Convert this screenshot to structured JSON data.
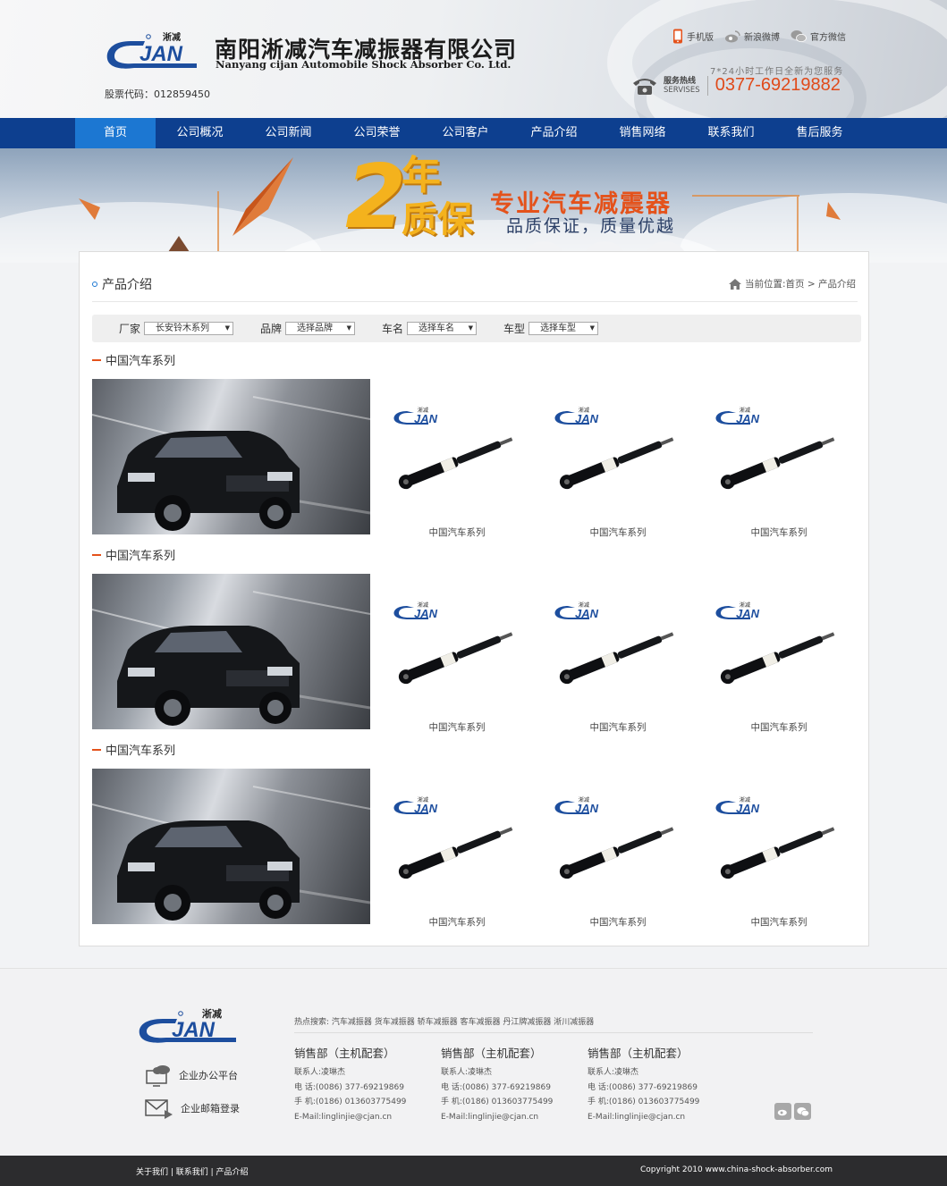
{
  "header": {
    "company_cn": "南阳淅减汽车减振器有限公司",
    "company_en": "Nanyang cijan Automobile Shock Absorber Co. Ltd.",
    "logo_cn": "淅减",
    "stock_code": "股票代码：012859450",
    "links": [
      {
        "label": "手机版",
        "icon": "mobile-icon"
      },
      {
        "label": "新浪微博",
        "icon": "weibo-icon"
      },
      {
        "label": "官方微信",
        "icon": "wechat-icon"
      }
    ],
    "service_note": "7*24小时工作日全新为您服务",
    "hotline_label": "服务热线",
    "hotline_en": "SERVISES",
    "phone": "0377-69219882"
  },
  "nav": {
    "items": [
      "首页",
      "公司概况",
      "公司新闻",
      "公司荣誉",
      "公司客户",
      "产品介绍",
      "销售网络",
      "联系我们",
      "售后服务"
    ],
    "active": "首页"
  },
  "banner": {
    "big_number": "2",
    "nian": "年",
    "zhibao": "质保",
    "title": "专业汽车减震器",
    "subtitle": "品质保证，质量优越"
  },
  "section": {
    "title": "产品介绍",
    "breadcrumb": "当前位置:首页 > 产品介绍"
  },
  "filters": [
    {
      "label": "厂家",
      "value": "长安铃木系列"
    },
    {
      "label": "品牌",
      "value": "选择品牌"
    },
    {
      "label": "车名",
      "value": "选择车名"
    },
    {
      "label": "车型",
      "value": "选择车型"
    }
  ],
  "categories": [
    {
      "title": "中国汽车系列",
      "products": [
        "中国汽车系列",
        "中国汽车系列",
        "中国汽车系列"
      ]
    },
    {
      "title": "中国汽车系列",
      "products": [
        "中国汽车系列",
        "中国汽车系列",
        "中国汽车系列"
      ]
    },
    {
      "title": "中国汽车系列",
      "products": [
        "中国汽车系列",
        "中国汽车系列",
        "中国汽车系列"
      ]
    }
  ],
  "footer": {
    "logo_cn": "淅减",
    "platform": "企业办公平台",
    "mail": "企业邮箱登录",
    "hot_search": "热点搜索:  汽车减振器 货车减振器 轿车减振器 客车减振器 丹江牌减振器 淅川减振器",
    "departments": [
      {
        "title": "销售部（主机配套）",
        "contact": "联系人:凌琳杰",
        "tel": "电 话:(0086) 377-69219869",
        "mobile": "手 机:(0186) 013603775499",
        "email": "E-Mail:linglinjie@cjan.cn"
      },
      {
        "title": "销售部（主机配套）",
        "contact": "联系人:凌琳杰",
        "tel": "电 话:(0086) 377-69219869",
        "mobile": "手 机:(0186) 013603775499",
        "email": "E-Mail:linglinjie@cjan.cn"
      },
      {
        "title": "销售部（主机配套）",
        "contact": "联系人:凌琳杰",
        "tel": "电 话:(0086) 377-69219869",
        "mobile": "手 机:(0186) 013603775499",
        "email": "E-Mail:linglinjie@cjan.cn"
      }
    ],
    "bottom_links": "关于我们 | 联系我们 | 产品介绍",
    "copyright": "Copyright 2010 www.china-shock-absorber.com"
  },
  "colors": {
    "nav_bg": "#0d3f8f",
    "nav_active": "#1c77d2",
    "accent_orange": "#e4521b",
    "phone": "#e04a1a"
  }
}
